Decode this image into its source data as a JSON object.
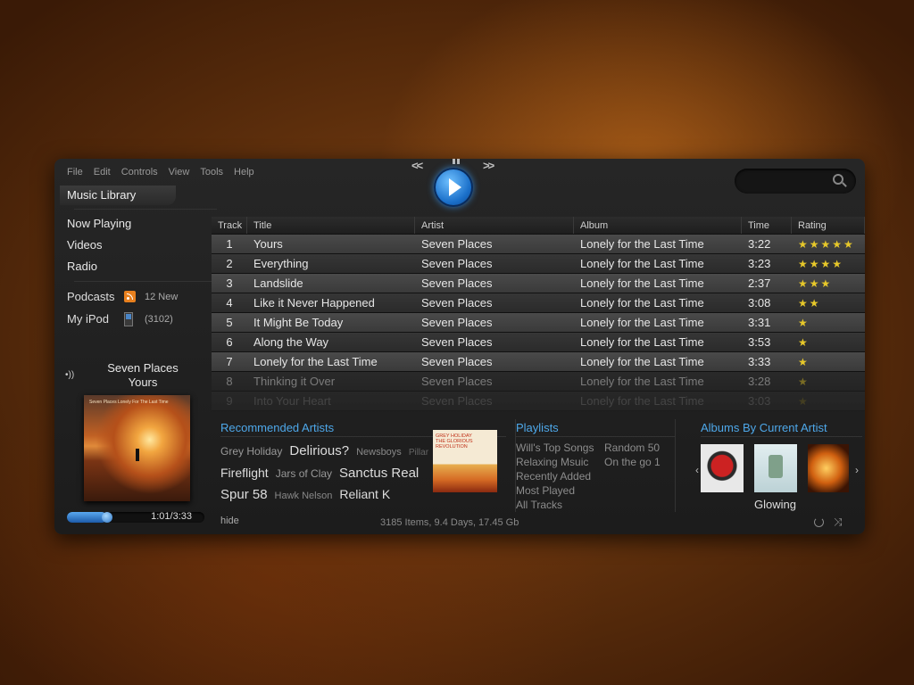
{
  "menu": [
    "File",
    "Edit",
    "Controls",
    "View",
    "Tools",
    "Help"
  ],
  "transport": {
    "rewind": "<<",
    "forward": ">>"
  },
  "search": {
    "placeholder": ""
  },
  "sidebar": {
    "library": "Music Library",
    "items": [
      "Now Playing",
      "Videos",
      "Radio"
    ],
    "podcasts": {
      "label": "Podcasts",
      "meta": "12 New"
    },
    "ipod": {
      "label": "My iPod",
      "meta": "(3102)"
    }
  },
  "now_playing": {
    "artist": "Seven Places",
    "title": "Yours",
    "cover_text": "Seven Places Lonely For The Last Time",
    "time": "1:01/3:33",
    "progress": 0.29
  },
  "table": {
    "headers": [
      "Track",
      "Title",
      "Artist",
      "Album",
      "Time",
      "Rating"
    ],
    "rows": [
      {
        "n": "1",
        "title": "Yours",
        "artist": "Seven Places",
        "album": "Lonely for the Last Time",
        "time": "3:22",
        "rating": 5
      },
      {
        "n": "2",
        "title": "Everything",
        "artist": "Seven Places",
        "album": "Lonely for the Last Time",
        "time": "3:23",
        "rating": 4
      },
      {
        "n": "3",
        "title": "Landslide",
        "artist": "Seven Places",
        "album": "Lonely for the Last Time",
        "time": "2:37",
        "rating": 3
      },
      {
        "n": "4",
        "title": "Like it Never Happened",
        "artist": "Seven Places",
        "album": "Lonely for the Last Time",
        "time": "3:08",
        "rating": 2
      },
      {
        "n": "5",
        "title": "It Might Be Today",
        "artist": "Seven Places",
        "album": "Lonely for the Last Time",
        "time": "3:31",
        "rating": 1
      },
      {
        "n": "6",
        "title": "Along the Way",
        "artist": "Seven Places",
        "album": "Lonely for the Last Time",
        "time": "3:53",
        "rating": 1
      },
      {
        "n": "7",
        "title": "Lonely for the Last Time",
        "artist": "Seven Places",
        "album": "Lonely for the Last Time",
        "time": "3:33",
        "rating": 1
      },
      {
        "n": "8",
        "title": "Thinking it Over",
        "artist": "Seven Places",
        "album": "Lonely for the Last Time",
        "time": "3:28",
        "rating": 1
      },
      {
        "n": "9",
        "title": "Into Your Heart",
        "artist": "Seven Places",
        "album": "Lonely for the Last Time",
        "time": "3:03",
        "rating": 1
      }
    ]
  },
  "recommended": {
    "title": "Recommended Artists",
    "tags": [
      {
        "text": "Grey Holiday",
        "size": "t-sm"
      },
      {
        "text": "Delirious?",
        "size": "t-lg"
      },
      {
        "text": "Newsboys",
        "size": "t-xs"
      },
      {
        "text": "Pillar",
        "size": "t-dim"
      },
      {
        "text": "Fireflight",
        "size": "t-md"
      },
      {
        "text": "Jars of Clay",
        "size": "t-sm"
      },
      {
        "text": "Sanctus Real",
        "size": "t-lg"
      },
      {
        "text": "Spur 58",
        "size": "t-lg"
      },
      {
        "text": "Hawk Nelson",
        "size": "t-xs"
      },
      {
        "text": "Reliant K",
        "size": "t-md"
      }
    ],
    "cover_text": "GREY HOLIDAY THE GLORIOUS REVOLUTION"
  },
  "playlists": {
    "title": "Playlists",
    "col1": [
      "Will's Top Songs",
      "Relaxing Msuic",
      "Recently Added",
      "Most Played",
      "All Tracks"
    ],
    "col2": [
      "Random 50",
      "On the go 1"
    ]
  },
  "albums": {
    "title": "Albums By Current Artist",
    "caption": "Glowing"
  },
  "status": {
    "hide": "hide",
    "summary": "3185 Items, 9.4 Days, 17.45 Gb"
  },
  "colors": {
    "accent": "#4ea8ea",
    "star": "#e7c82a",
    "play": "#1a6fc9"
  }
}
